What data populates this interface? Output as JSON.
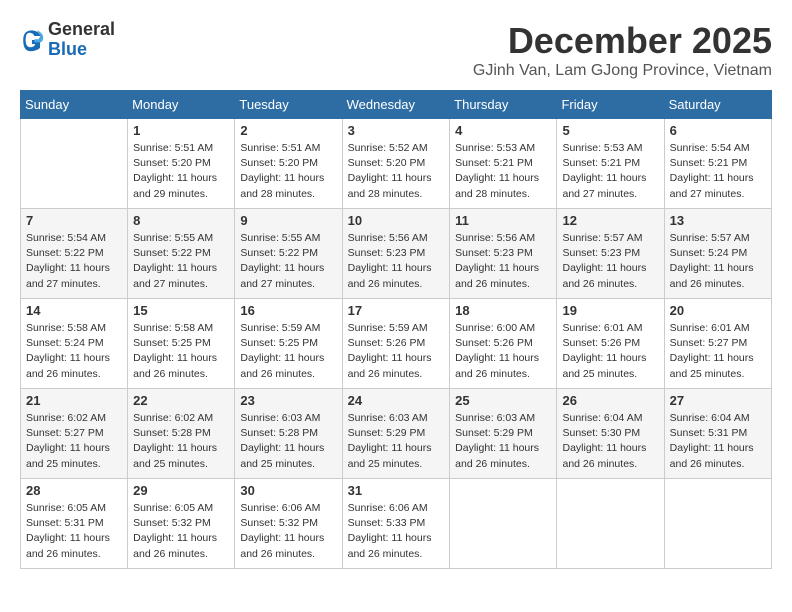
{
  "header": {
    "logo_general": "General",
    "logo_blue": "Blue",
    "title": "December 2025",
    "subtitle": "GJinh Van, Lam GJong Province, Vietnam"
  },
  "columns": [
    "Sunday",
    "Monday",
    "Tuesday",
    "Wednesday",
    "Thursday",
    "Friday",
    "Saturday"
  ],
  "weeks": [
    [
      {
        "num": "",
        "info": ""
      },
      {
        "num": "1",
        "info": "Sunrise: 5:51 AM\nSunset: 5:20 PM\nDaylight: 11 hours\nand 29 minutes."
      },
      {
        "num": "2",
        "info": "Sunrise: 5:51 AM\nSunset: 5:20 PM\nDaylight: 11 hours\nand 28 minutes."
      },
      {
        "num": "3",
        "info": "Sunrise: 5:52 AM\nSunset: 5:20 PM\nDaylight: 11 hours\nand 28 minutes."
      },
      {
        "num": "4",
        "info": "Sunrise: 5:53 AM\nSunset: 5:21 PM\nDaylight: 11 hours\nand 28 minutes."
      },
      {
        "num": "5",
        "info": "Sunrise: 5:53 AM\nSunset: 5:21 PM\nDaylight: 11 hours\nand 27 minutes."
      },
      {
        "num": "6",
        "info": "Sunrise: 5:54 AM\nSunset: 5:21 PM\nDaylight: 11 hours\nand 27 minutes."
      }
    ],
    [
      {
        "num": "7",
        "info": "Sunrise: 5:54 AM\nSunset: 5:22 PM\nDaylight: 11 hours\nand 27 minutes."
      },
      {
        "num": "8",
        "info": "Sunrise: 5:55 AM\nSunset: 5:22 PM\nDaylight: 11 hours\nand 27 minutes."
      },
      {
        "num": "9",
        "info": "Sunrise: 5:55 AM\nSunset: 5:22 PM\nDaylight: 11 hours\nand 27 minutes."
      },
      {
        "num": "10",
        "info": "Sunrise: 5:56 AM\nSunset: 5:23 PM\nDaylight: 11 hours\nand 26 minutes."
      },
      {
        "num": "11",
        "info": "Sunrise: 5:56 AM\nSunset: 5:23 PM\nDaylight: 11 hours\nand 26 minutes."
      },
      {
        "num": "12",
        "info": "Sunrise: 5:57 AM\nSunset: 5:23 PM\nDaylight: 11 hours\nand 26 minutes."
      },
      {
        "num": "13",
        "info": "Sunrise: 5:57 AM\nSunset: 5:24 PM\nDaylight: 11 hours\nand 26 minutes."
      }
    ],
    [
      {
        "num": "14",
        "info": "Sunrise: 5:58 AM\nSunset: 5:24 PM\nDaylight: 11 hours\nand 26 minutes."
      },
      {
        "num": "15",
        "info": "Sunrise: 5:58 AM\nSunset: 5:25 PM\nDaylight: 11 hours\nand 26 minutes."
      },
      {
        "num": "16",
        "info": "Sunrise: 5:59 AM\nSunset: 5:25 PM\nDaylight: 11 hours\nand 26 minutes."
      },
      {
        "num": "17",
        "info": "Sunrise: 5:59 AM\nSunset: 5:26 PM\nDaylight: 11 hours\nand 26 minutes."
      },
      {
        "num": "18",
        "info": "Sunrise: 6:00 AM\nSunset: 5:26 PM\nDaylight: 11 hours\nand 26 minutes."
      },
      {
        "num": "19",
        "info": "Sunrise: 6:01 AM\nSunset: 5:26 PM\nDaylight: 11 hours\nand 25 minutes."
      },
      {
        "num": "20",
        "info": "Sunrise: 6:01 AM\nSunset: 5:27 PM\nDaylight: 11 hours\nand 25 minutes."
      }
    ],
    [
      {
        "num": "21",
        "info": "Sunrise: 6:02 AM\nSunset: 5:27 PM\nDaylight: 11 hours\nand 25 minutes."
      },
      {
        "num": "22",
        "info": "Sunrise: 6:02 AM\nSunset: 5:28 PM\nDaylight: 11 hours\nand 25 minutes."
      },
      {
        "num": "23",
        "info": "Sunrise: 6:03 AM\nSunset: 5:28 PM\nDaylight: 11 hours\nand 25 minutes."
      },
      {
        "num": "24",
        "info": "Sunrise: 6:03 AM\nSunset: 5:29 PM\nDaylight: 11 hours\nand 25 minutes."
      },
      {
        "num": "25",
        "info": "Sunrise: 6:03 AM\nSunset: 5:29 PM\nDaylight: 11 hours\nand 26 minutes."
      },
      {
        "num": "26",
        "info": "Sunrise: 6:04 AM\nSunset: 5:30 PM\nDaylight: 11 hours\nand 26 minutes."
      },
      {
        "num": "27",
        "info": "Sunrise: 6:04 AM\nSunset: 5:31 PM\nDaylight: 11 hours\nand 26 minutes."
      }
    ],
    [
      {
        "num": "28",
        "info": "Sunrise: 6:05 AM\nSunset: 5:31 PM\nDaylight: 11 hours\nand 26 minutes."
      },
      {
        "num": "29",
        "info": "Sunrise: 6:05 AM\nSunset: 5:32 PM\nDaylight: 11 hours\nand 26 minutes."
      },
      {
        "num": "30",
        "info": "Sunrise: 6:06 AM\nSunset: 5:32 PM\nDaylight: 11 hours\nand 26 minutes."
      },
      {
        "num": "31",
        "info": "Sunrise: 6:06 AM\nSunset: 5:33 PM\nDaylight: 11 hours\nand 26 minutes."
      },
      {
        "num": "",
        "info": ""
      },
      {
        "num": "",
        "info": ""
      },
      {
        "num": "",
        "info": ""
      }
    ]
  ]
}
